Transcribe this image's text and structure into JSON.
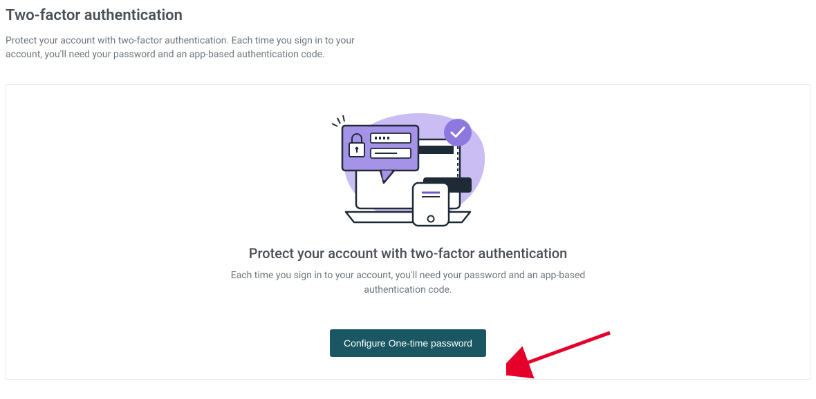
{
  "header": {
    "title": "Two-factor authentication",
    "subtitle": "Protect your account with two-factor authentication. Each time you sign in to your account, you'll need your password and an app-based authentication code."
  },
  "card": {
    "heading": "Protect your account with two-factor authentication",
    "text": "Each time you sign in to your account, you'll need your password and an app-based authentication code.",
    "button_label": "Configure One-time password"
  }
}
